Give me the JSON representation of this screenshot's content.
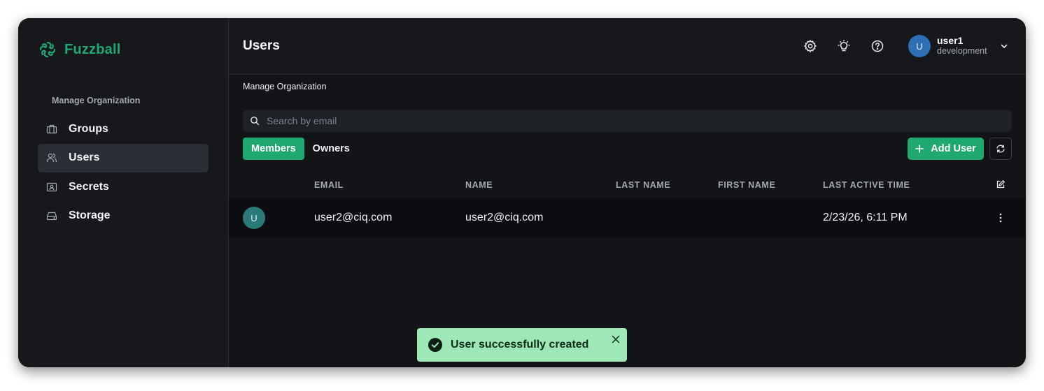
{
  "app": {
    "brand_name": "Fuzzball",
    "brand_color": "#1fa971"
  },
  "sidebar": {
    "section_label": "Manage Organization",
    "items": [
      {
        "label": "Groups",
        "icon": "briefcase-icon",
        "active": false
      },
      {
        "label": "Users",
        "icon": "users-icon",
        "active": true
      },
      {
        "label": "Secrets",
        "icon": "secret-icon",
        "active": false
      },
      {
        "label": "Storage",
        "icon": "storage-icon",
        "active": false
      }
    ]
  },
  "header": {
    "title": "Users",
    "icons": [
      "gear-icon",
      "lightbulb-icon",
      "help-icon"
    ],
    "user": {
      "initial": "U",
      "name": "user1",
      "org": "development"
    }
  },
  "content": {
    "breadcrumb": "Manage Organization",
    "search": {
      "placeholder": "Search by email",
      "value": ""
    },
    "tabs": [
      {
        "label": "Members",
        "active": true
      },
      {
        "label": "Owners",
        "active": false
      }
    ],
    "add_user_label": "Add User",
    "table": {
      "columns": [
        "EMAIL",
        "NAME",
        "LAST NAME",
        "FIRST NAME",
        "LAST ACTIVE TIME"
      ],
      "rows": [
        {
          "initial": "U",
          "email": "user2@ciq.com",
          "name": "user2@ciq.com",
          "last_name": "",
          "first_name": "",
          "last_active": "2/23/26, 6:11 PM"
        }
      ]
    }
  },
  "toast": {
    "message": "User successfully created",
    "color": "#9de8b6"
  }
}
